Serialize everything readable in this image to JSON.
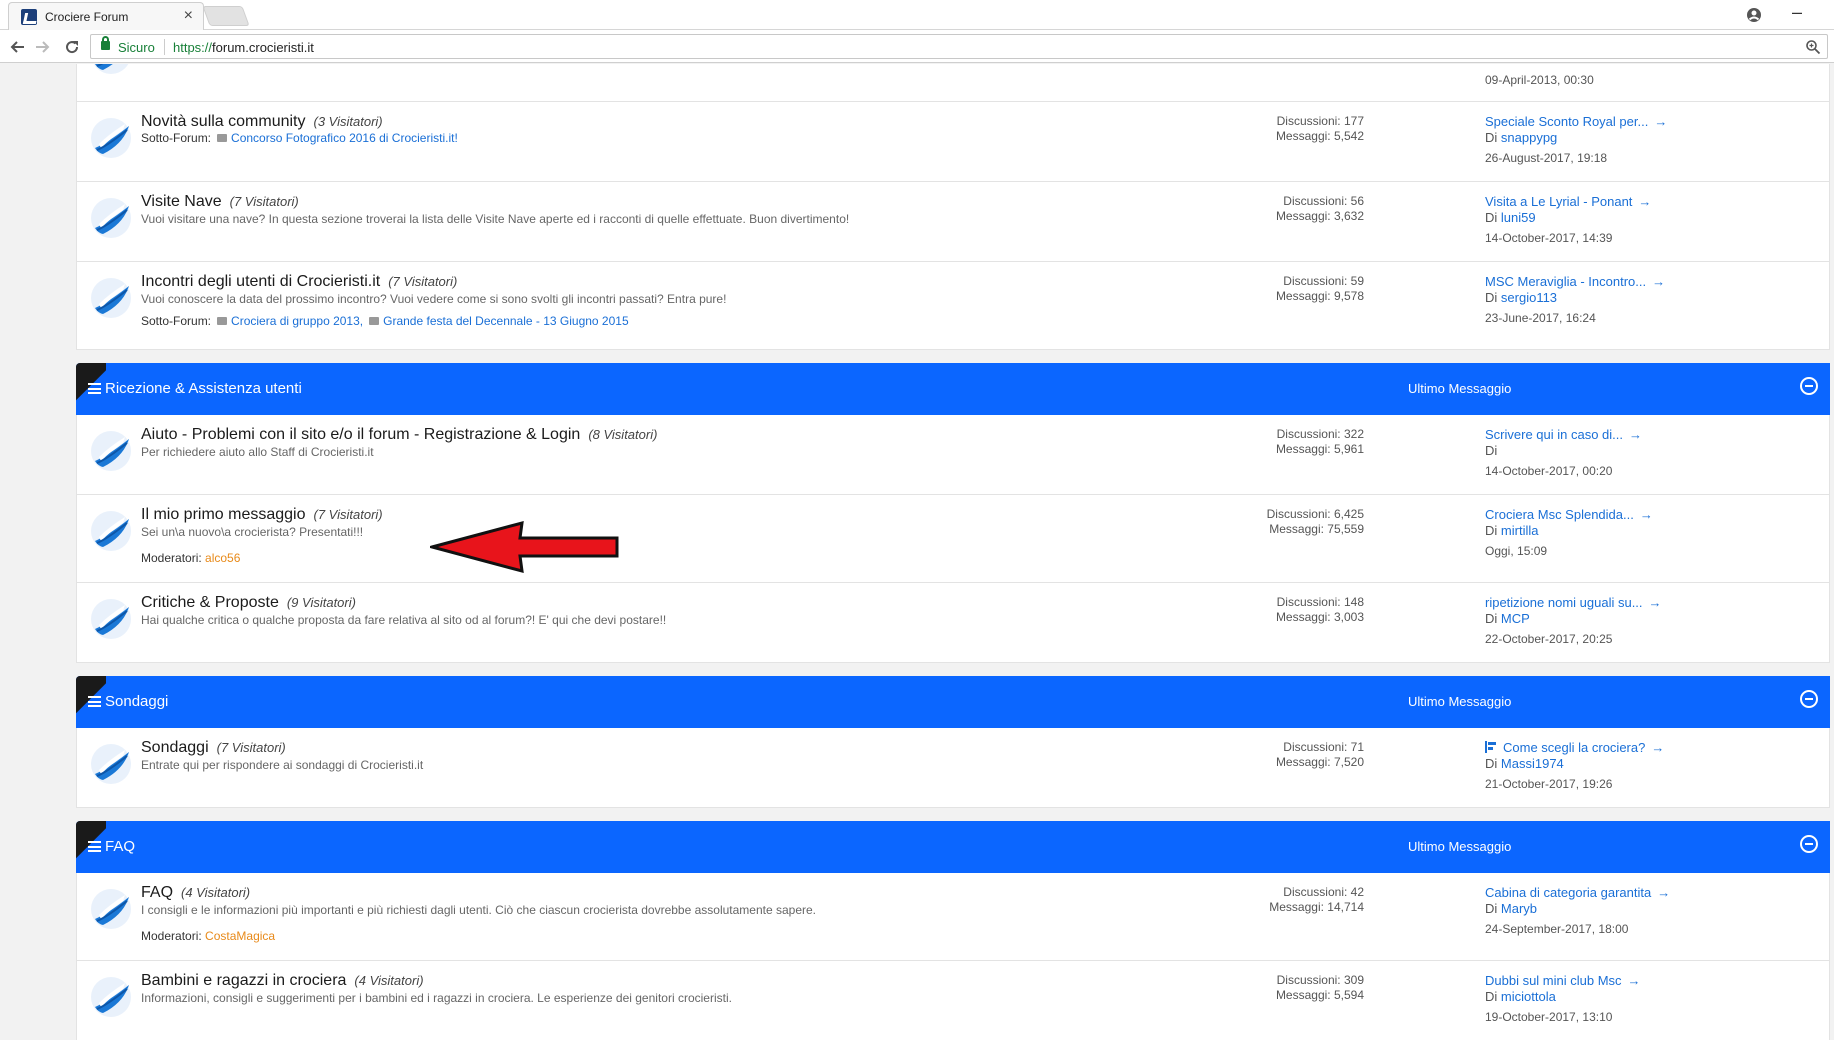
{
  "browser": {
    "tab_title": "Crociere Forum",
    "tab_close": "×",
    "secure_label": "Sicuro",
    "url_scheme": "https://",
    "url_host": "forum.crocieristi.it",
    "minimize": "–"
  },
  "top_partial": {
    "date": "09-April-2013, 00:30"
  },
  "sections_top": {
    "rows": [
      {
        "title": "Novità sulla community",
        "visitors": "(3 Visitatori)",
        "subforum_label": "Sotto-Forum:",
        "subforums": [
          "Concorso Fotografico 2016 di Crocieristi.it!"
        ],
        "discussions": "Discussioni: 177",
        "messages": "Messaggi: 5,542",
        "last_title": "Speciale Sconto Royal per...",
        "last_by_prefix": "Di",
        "last_user": "snappypg",
        "last_date": "26-August-2017, 19:18"
      },
      {
        "title": "Visite Nave",
        "visitors": "(7 Visitatori)",
        "desc": "Vuoi visitare una nave? In questa sezione troverai la lista delle Visite Nave aperte ed i racconti di quelle effettuate. Buon divertimento!",
        "discussions": "Discussioni: 56",
        "messages": "Messaggi: 3,632",
        "last_title": "Visita a Le Lyrial - Ponant",
        "last_by_prefix": "Di",
        "last_user": "luni59",
        "last_date": "14-October-2017, 14:39"
      },
      {
        "title": "Incontri degli utenti di Crocieristi.it",
        "visitors": "(7 Visitatori)",
        "desc": "Vuoi conoscere la data del prossimo incontro? Vuoi vedere come si sono svolti gli incontri passati? Entra pure!",
        "subforum_label": "Sotto-Forum:",
        "subforums": [
          "Crociera di gruppo 2013,",
          "Grande festa del Decennale - 13 Giugno 2015"
        ],
        "discussions": "Discussioni: 59",
        "messages": "Messaggi: 9,578",
        "last_title": "MSC Meraviglia - Incontro...",
        "last_by_prefix": "Di",
        "last_user": "sergio113",
        "last_date": "23-June-2017, 16:24"
      }
    ]
  },
  "categories": [
    {
      "title": "Ricezione & Assistenza utenti",
      "last_label": "Ultimo Messaggio",
      "rows": [
        {
          "title": "Aiuto - Problemi con il sito e/o il forum - Registrazione & Login",
          "visitors": "(8 Visitatori)",
          "desc": "Per richiedere aiuto allo Staff di Crocieristi.it",
          "discussions": "Discussioni: 322",
          "messages": "Messaggi: 5,961",
          "last_title": "Scrivere qui in caso di...",
          "last_by_prefix": "Di",
          "last_user": "",
          "last_date": "14-October-2017, 00:20"
        },
        {
          "title": "Il mio primo messaggio",
          "visitors": "(7 Visitatori)",
          "desc": "Sei un\\a nuovo\\a crocierista? Presentati!!!",
          "mod_label": "Moderatori:",
          "mod_name": "alco56",
          "discussions": "Discussioni: 6,425",
          "messages": "Messaggi: 75,559",
          "last_title": "Crociera Msc Splendida...",
          "last_by_prefix": "Di",
          "last_user": "mirtilla",
          "last_date": "Oggi, 15:09"
        },
        {
          "title": "Critiche & Proposte",
          "visitors": "(9 Visitatori)",
          "desc": "Hai qualche critica o qualche proposta da fare relativa al sito od al forum?! E' qui che devi postare!!",
          "discussions": "Discussioni: 148",
          "messages": "Messaggi: 3,003",
          "last_title": "ripetizione nomi uguali su...",
          "last_by_prefix": "Di",
          "last_user": "MCP",
          "last_date": "22-October-2017, 20:25"
        }
      ]
    },
    {
      "title": "Sondaggi",
      "last_label": "Ultimo Messaggio",
      "rows": [
        {
          "title": "Sondaggi",
          "visitors": "(7 Visitatori)",
          "desc": "Entrate qui per rispondere ai sondaggi di Crocieristi.it",
          "discussions": "Discussioni: 71",
          "messages": "Messaggi: 7,520",
          "last_title": "Come scegli la crociera?",
          "last_by_prefix": "Di",
          "last_user": "Massi1974",
          "last_date": "21-October-2017, 19:26"
        }
      ]
    },
    {
      "title": "FAQ",
      "last_label": "Ultimo Messaggio",
      "rows": [
        {
          "title": "FAQ",
          "visitors": "(4 Visitatori)",
          "desc": "I consigli e le informazioni più importanti e più richiesti dagli utenti. Ciò che ciascun crocierista dovrebbe assolutamente sapere.",
          "mod_label": "Moderatori:",
          "mod_name": "CostaMagica",
          "discussions": "Discussioni: 42",
          "messages": "Messaggi: 14,714",
          "last_title": "Cabina di categoria garantita",
          "last_by_prefix": "Di",
          "last_user": "Maryb",
          "last_date": "24-September-2017, 18:00"
        },
        {
          "title": "Bambini e ragazzi in crociera",
          "visitors": "(4 Visitatori)",
          "desc": "Informazioni, consigli e suggerimenti per i bambini ed i ragazzi in crociera. Le esperienze dei genitori crocieristi.",
          "discussions": "Discussioni: 309",
          "messages": "Messaggi: 5,594",
          "last_title": "Dubbi sul mini club Msc",
          "last_by_prefix": "Di",
          "last_user": "miciottola",
          "last_date": "19-October-2017, 13:10"
        }
      ]
    }
  ],
  "colors": {
    "category_header": "#0b66ff",
    "link": "#1a6fd6",
    "moderator": "#e88a1a",
    "annotation_arrow": "#e8141b"
  },
  "icons": {
    "forum": "ship-sail-icon",
    "back": "back-arrow-icon",
    "forward": "forward-arrow-icon",
    "reload": "reload-icon",
    "lock": "lock-icon",
    "zoom": "zoom-icon",
    "profile": "profile-icon",
    "collapse": "collapse-minus-icon",
    "menu": "menu-bars-icon",
    "last_arrow": "go-arrow-icon",
    "poll": "poll-icon"
  }
}
